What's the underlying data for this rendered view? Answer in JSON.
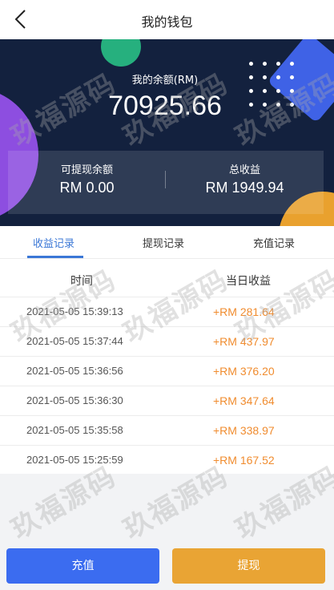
{
  "navbar": {
    "title": "我的钱包",
    "back_icon": "chevron-left-icon"
  },
  "hero": {
    "balance_label": "我的余额(RM)",
    "balance_value": "70925.66",
    "withdrawable_label": "可提现余额",
    "withdrawable_value": "RM 0.00",
    "total_income_label": "总收益",
    "total_income_value": "RM 1949.94",
    "colors": {
      "background": "#13213e",
      "green": "#26b07e",
      "purple": "#8d4ee0",
      "blue": "#3f62e6",
      "orange": "#e9a12e"
    }
  },
  "tabs": [
    {
      "label": "收益记录",
      "active": true
    },
    {
      "label": "提现记录",
      "active": false
    },
    {
      "label": "充值记录",
      "active": false
    }
  ],
  "table": {
    "headers": {
      "time": "时间",
      "amount": "当日收益"
    },
    "rows": [
      {
        "time": "2021-05-05 15:39:13",
        "amount": "+RM 281.64"
      },
      {
        "time": "2021-05-05 15:37:44",
        "amount": "+RM 437.97"
      },
      {
        "time": "2021-05-05 15:36:56",
        "amount": "+RM 376.20"
      },
      {
        "time": "2021-05-05 15:36:30",
        "amount": "+RM 347.64"
      },
      {
        "time": "2021-05-05 15:35:58",
        "amount": "+RM 338.97"
      },
      {
        "time": "2021-05-05 15:25:59",
        "amount": "+RM 167.52"
      }
    ]
  },
  "buttons": {
    "recharge": "充值",
    "withdraw": "提现"
  },
  "watermark": "玖福源码",
  "accent_colors": {
    "tab_active": "#3a77d6",
    "amount": "#f08c2f",
    "recharge_button": "#3b6cf0",
    "withdraw_button": "#e9a434"
  }
}
